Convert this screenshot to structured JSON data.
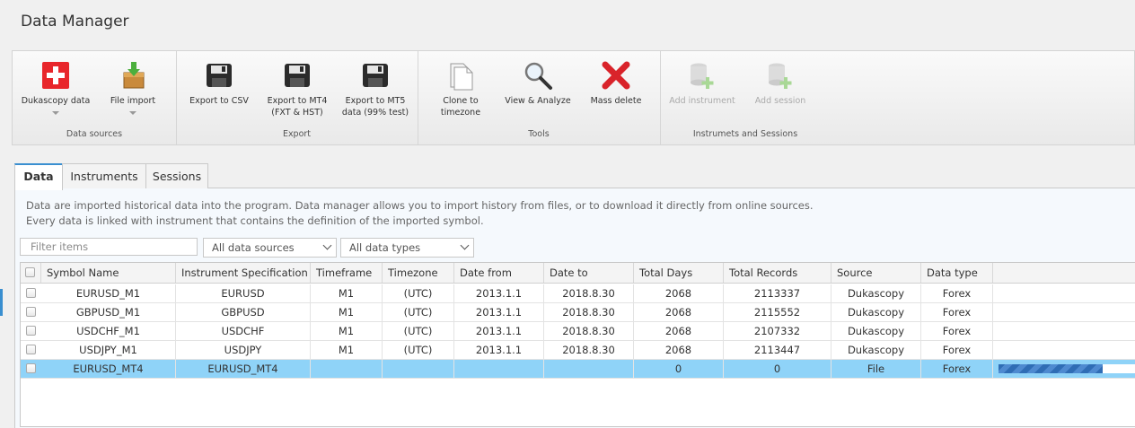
{
  "window": {
    "title": "Data Manager"
  },
  "ribbon": {
    "groups": [
      {
        "label": "Data sources",
        "buttons": [
          {
            "label": "Dukascopy data",
            "icon": "swiss-flag-icon",
            "dropdown": true
          },
          {
            "label": "File import",
            "icon": "file-import-icon",
            "dropdown": true
          }
        ]
      },
      {
        "label": "Export",
        "buttons": [
          {
            "label": "Export to CSV",
            "icon": "floppy-disk-icon"
          },
          {
            "label": "Export to MT4 (FXT & HST)",
            "line1": "Export to MT4",
            "line2": "(FXT & HST)",
            "icon": "floppy-disk-icon"
          },
          {
            "label": "Export to MT5 data (99% test)",
            "line1": "Export to MT5",
            "line2": "data (99% test)",
            "icon": "floppy-disk-icon"
          }
        ]
      },
      {
        "label": "Tools",
        "buttons": [
          {
            "label": "Clone to timezone",
            "line1": "Clone to",
            "line2": "timezone",
            "icon": "clone-document-icon"
          },
          {
            "label": "View & Analyze",
            "icon": "magnifier-icon"
          },
          {
            "label": "Mass delete",
            "icon": "red-x-delete-icon"
          }
        ]
      },
      {
        "label": "Instrumets and Sessions",
        "buttons": [
          {
            "label": "Add instrument",
            "icon": "database-add-icon",
            "disabled": true
          },
          {
            "label": "Add session",
            "icon": "database-add-icon",
            "disabled": true
          }
        ]
      }
    ]
  },
  "tabs": [
    {
      "label": "Data",
      "active": true
    },
    {
      "label": "Instruments",
      "active": false
    },
    {
      "label": "Sessions",
      "active": false
    }
  ],
  "description": {
    "line1": "Data are imported historical data into the program. Data manager allows you to import history from files, or to download it directly from online sources.",
    "line2": "Every data is linked with instrument that contains the definition of the imported symbol."
  },
  "filters": {
    "filter_placeholder": "Filter items",
    "source_select": "All data sources",
    "type_select": "All data types"
  },
  "table": {
    "columns": [
      "Symbol Name",
      "Instrument Specification",
      "Timeframe",
      "Timezone",
      "Date from",
      "Date to",
      "Total Days",
      "Total Records",
      "Source",
      "Data type"
    ],
    "rows": [
      {
        "symbol": "EURUSD_M1",
        "spec": "EURUSD",
        "tf": "M1",
        "tz": "(UTC)",
        "from": "2013.1.1",
        "to": "2018.8.30",
        "days": "2068",
        "records": "2113337",
        "source": "Dukascopy",
        "type": "Forex",
        "selected": false
      },
      {
        "symbol": "GBPUSD_M1",
        "spec": "GBPUSD",
        "tf": "M1",
        "tz": "(UTC)",
        "from": "2013.1.1",
        "to": "2018.8.30",
        "days": "2068",
        "records": "2115552",
        "source": "Dukascopy",
        "type": "Forex",
        "selected": false
      },
      {
        "symbol": "USDCHF_M1",
        "spec": "USDCHF",
        "tf": "M1",
        "tz": "(UTC)",
        "from": "2013.1.1",
        "to": "2018.8.30",
        "days": "2068",
        "records": "2107332",
        "source": "Dukascopy",
        "type": "Forex",
        "selected": false
      },
      {
        "symbol": "USDJPY_M1",
        "spec": "USDJPY",
        "tf": "M1",
        "tz": "(UTC)",
        "from": "2013.1.1",
        "to": "2018.8.30",
        "days": "2068",
        "records": "2113447",
        "source": "Dukascopy",
        "type": "Forex",
        "selected": false
      },
      {
        "symbol": "EURUSD_MT4",
        "spec": "EURUSD_MT4",
        "tf": "",
        "tz": "",
        "from": "",
        "to": "",
        "days": "0",
        "records": "0",
        "source": "File",
        "type": "Forex",
        "selected": true,
        "progress": 0.76
      }
    ]
  },
  "colors": {
    "accent": "#3a8fd0",
    "selected_row": "#8fd3f8",
    "progress": "#2f6db5"
  }
}
